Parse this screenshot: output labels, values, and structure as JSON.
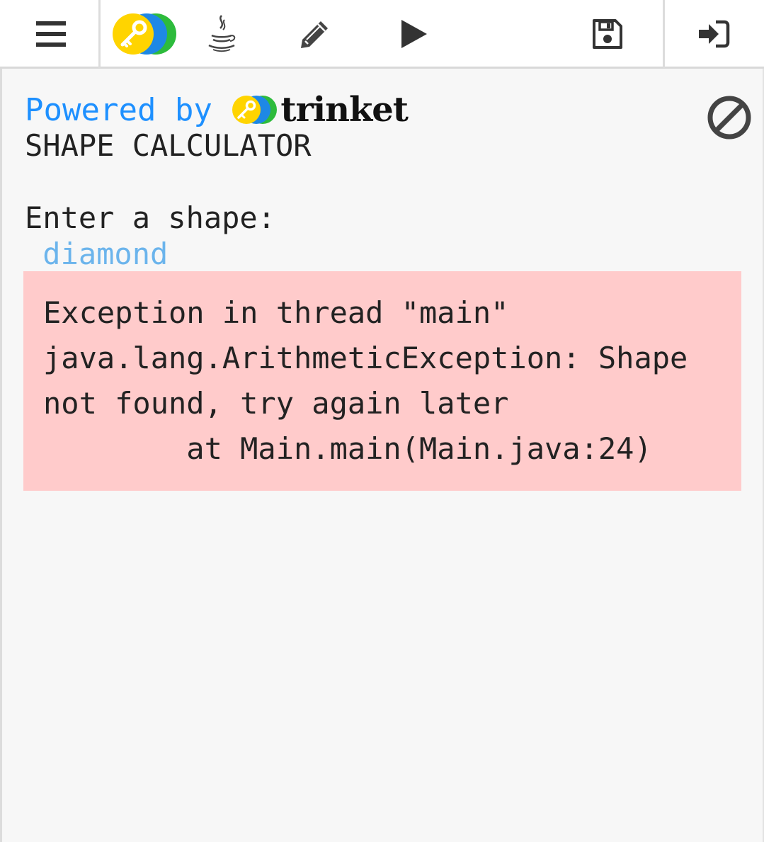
{
  "toolbar": {
    "items": [
      {
        "name": "menu",
        "icon": "hamburger-menu-icon"
      },
      {
        "name": "trinket-logo",
        "icon": "trinket-logo-icon"
      },
      {
        "name": "java",
        "icon": "java-cup-icon"
      },
      {
        "name": "edit",
        "icon": "pencil-icon"
      },
      {
        "name": "run",
        "icon": "play-icon"
      },
      {
        "name": "save",
        "icon": "save-icon"
      },
      {
        "name": "login",
        "icon": "sign-in-icon"
      }
    ]
  },
  "console": {
    "powered_by": "Powered by ",
    "brand": "trinket",
    "lines": [
      "SHAPE CALCULATOR",
      "",
      "Enter a shape:"
    ],
    "input_echo": " diamond",
    "error": [
      "Exception in thread \"main\"",
      "java.lang.ArithmeticException: Shape",
      "not found, try again later",
      "        at Main.main(Main.java:24)"
    ],
    "stop_icon": "stop-icon"
  },
  "colors": {
    "powered_by": "#1e90ff",
    "input_echo": "#6bb4ec",
    "error_bg": "#ffcbcb",
    "console_bg": "#f7f7f7",
    "logo_yellow": "#ffd400",
    "logo_blue": "#1e88e5",
    "logo_green": "#2dbb3c"
  }
}
